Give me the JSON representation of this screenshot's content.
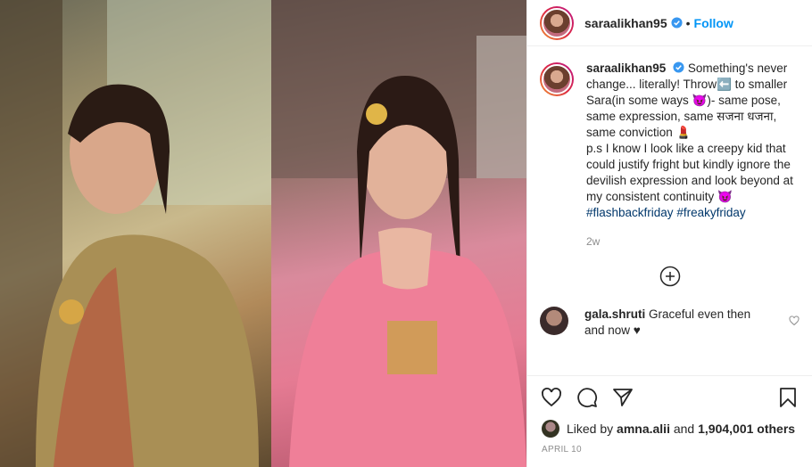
{
  "post": {
    "username": "saraalikhan95",
    "follow_label": "Follow",
    "separator": "•"
  },
  "caption": {
    "username": "saraalikhan95",
    "text_1": "Something's never change... literally! Throw",
    "text_2": " to smaller Sara(in some ways ",
    "text_3": ")- same pose, same expression, same सजना धजना, same conviction ",
    "text_4": "p.s I know I look like a creepy kid that could justify fright but kindly ignore the devilish expression and look beyond at my consistent continuity ",
    "hashtags": [
      "#flashbackfriday",
      "#freakyfriday"
    ],
    "time": "2w"
  },
  "comment": {
    "username": "gala.shruti",
    "text": "Graceful even then and now ♥"
  },
  "likes": {
    "prefix": "Liked by ",
    "user": "amna.alii",
    "middle": " and ",
    "count": "1,904,001 others"
  },
  "date": "APRIL 10",
  "icons": {
    "verified": "verified-badge-icon",
    "like": "heart-icon",
    "comment": "comment-icon",
    "share": "paper-plane-icon",
    "save": "bookmark-icon",
    "more": "plus-circle-icon"
  },
  "colors": {
    "accent": "#0095f6",
    "hashtag": "#00376b",
    "muted": "#8e8e8e"
  }
}
